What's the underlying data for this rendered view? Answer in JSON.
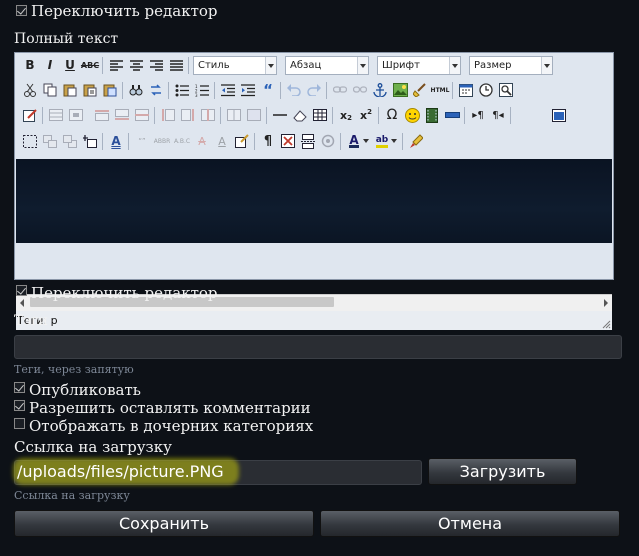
{
  "toggle_editor_top": "Переключить редактор",
  "full_text_label": "Полный текст",
  "toolbar": {
    "style_dropdown": "Стиль",
    "format_dropdown": "Абзац",
    "font_dropdown": "Шрифт",
    "size_dropdown": "Размер",
    "bold_icon": "B",
    "italic_icon": "I",
    "underline_icon": "U",
    "strike_icon": "ABC",
    "html_icon": "HTML",
    "omega_icon": "Ω",
    "quote_icon": "“",
    "pilcrow_icon": "¶"
  },
  "editor_status": "Теги: p",
  "toggle_editor_bottom": "Переключить редактор",
  "tags_label": "Тэги",
  "tags_hint": "Теги, через запятую",
  "publish_label": "Опубликовать",
  "comments_label": "Разрешить оставлять комментарии",
  "subcategories_label": "Отображать в дочерних категориях",
  "download_link_label": "Ссылка на загрузку",
  "download_link_value": "/uploads/files/picture.PNG",
  "download_link_hint": "Ссылка на загрузку",
  "upload_button": "Загрузить",
  "save_button": "Сохранить",
  "cancel_button": "Отмена",
  "colors": {
    "page_bg": "#0d1117",
    "highlight": "#f0f000"
  }
}
